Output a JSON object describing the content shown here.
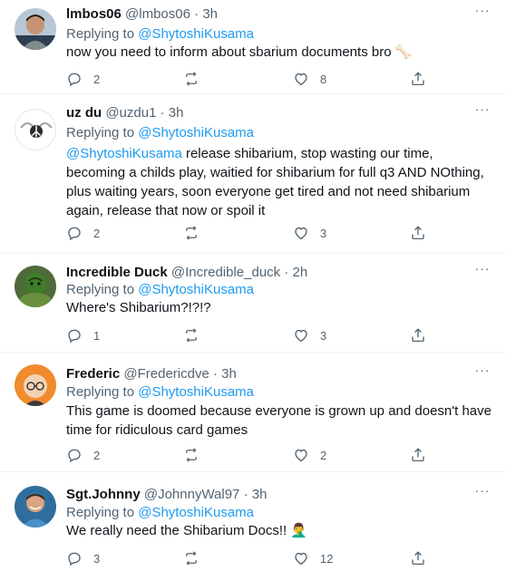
{
  "colors": {
    "link": "#1d9bf0",
    "secondary": "#536471",
    "text": "#0f1419",
    "divider": "#eff3f4"
  },
  "icons": {
    "more": "more-icon",
    "reply": "reply-icon",
    "retweet": "retweet-icon",
    "like": "heart-icon",
    "share": "share-icon"
  },
  "tweets": [
    {
      "name": "lmbos06",
      "handle": "@lmbos06",
      "dot": "·",
      "time": "3h",
      "replying_prefix": "Replying to ",
      "replying_to": "@ShytoshiKusama",
      "text": "now you need to inform about sbarium documents bro 🦴",
      "replies": "2",
      "retweets": "",
      "likes": "8"
    },
    {
      "name": "uz du",
      "handle": "@uzdu1",
      "dot": "·",
      "time": "3h",
      "replying_prefix": "Replying to ",
      "replying_to": "@ShytoshiKusama",
      "mention": "@ShytoshiKusama",
      "text": " release shibarium, stop wasting our time, becoming a childs play, waitied for shibarium for full q3 AND NOthing, plus waiting years, soon everyone get tired and not need shibarium again, release that now or spoil it",
      "replies": "2",
      "retweets": "",
      "likes": "3"
    },
    {
      "name": "Incredible Duck",
      "handle": "@Incredible_duck",
      "dot": "·",
      "time": "2h",
      "replying_prefix": "Replying to ",
      "replying_to": "@ShytoshiKusama",
      "text": "Where's Shibarium?!?!?",
      "replies": "1",
      "retweets": "",
      "likes": "3"
    },
    {
      "name": "Frederic",
      "handle": "@Fredericdve",
      "dot": "·",
      "time": "3h",
      "replying_prefix": "Replying to ",
      "replying_to": "@ShytoshiKusama",
      "text": "This game is doomed because everyone is grown up and doesn't have time for ridiculous card games",
      "replies": "2",
      "retweets": "",
      "likes": "2"
    },
    {
      "name": "Sgt.Johnny",
      "handle": "@JohnnyWal97",
      "dot": "·",
      "time": "3h",
      "replying_prefix": "Replying to ",
      "replying_to": "@ShytoshiKusama",
      "text": "We really need the Shibarium Docs!! 🤦‍♂️",
      "replies": "3",
      "retweets": "",
      "likes": "12"
    }
  ]
}
